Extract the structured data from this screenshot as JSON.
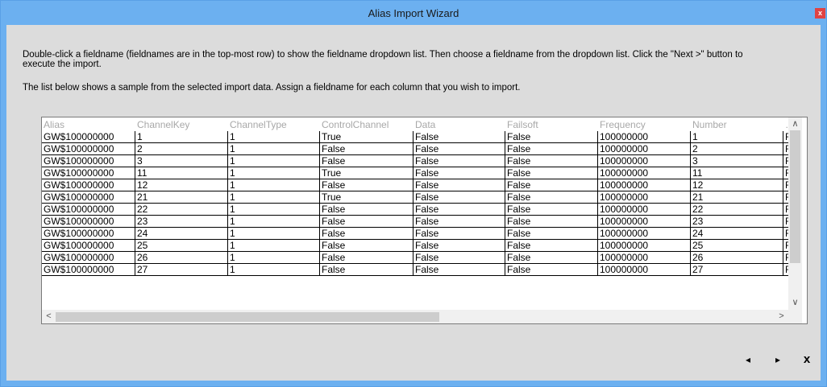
{
  "window": {
    "title": "Alias Import Wizard",
    "close_glyph": "x"
  },
  "instructions": {
    "line1": "Double-click a fieldname (fieldnames are in the top-most row) to show the fieldname dropdown list.  Then choose a fieldname from the dropdown list.  Click the \"Next >\" button to execute the import.",
    "line2": "The list below shows a sample from the selected import data.  Assign a fieldname for each column that you wish to import."
  },
  "grid": {
    "headers": [
      "Alias",
      "ChannelKey",
      "ChannelType",
      "ControlChannel",
      "Data",
      "Failsoft",
      "Frequency",
      "Number",
      "…"
    ],
    "rows": [
      [
        "GW$100000000",
        "1",
        "1",
        "True",
        "False",
        "False",
        "100000000",
        "1",
        "F"
      ],
      [
        "GW$100000000",
        "2",
        "1",
        "False",
        "False",
        "False",
        "100000000",
        "2",
        "F"
      ],
      [
        "GW$100000000",
        "3",
        "1",
        "False",
        "False",
        "False",
        "100000000",
        "3",
        "F"
      ],
      [
        "GW$100000000",
        "11",
        "1",
        "True",
        "False",
        "False",
        "100000000",
        "11",
        "F"
      ],
      [
        "GW$100000000",
        "12",
        "1",
        "False",
        "False",
        "False",
        "100000000",
        "12",
        "F"
      ],
      [
        "GW$100000000",
        "21",
        "1",
        "True",
        "False",
        "False",
        "100000000",
        "21",
        "F"
      ],
      [
        "GW$100000000",
        "22",
        "1",
        "False",
        "False",
        "False",
        "100000000",
        "22",
        "F"
      ],
      [
        "GW$100000000",
        "23",
        "1",
        "False",
        "False",
        "False",
        "100000000",
        "23",
        "F"
      ],
      [
        "GW$100000000",
        "24",
        "1",
        "False",
        "False",
        "False",
        "100000000",
        "24",
        "F"
      ],
      [
        "GW$100000000",
        "25",
        "1",
        "False",
        "False",
        "False",
        "100000000",
        "25",
        "F"
      ],
      [
        "GW$100000000",
        "26",
        "1",
        "False",
        "False",
        "False",
        "100000000",
        "26",
        "F"
      ],
      [
        "GW$100000000",
        "27",
        "1",
        "False",
        "False",
        "False",
        "100000000",
        "27",
        "F"
      ]
    ]
  },
  "scroll": {
    "up": "∧",
    "down": "∨",
    "left": "<",
    "right": ">"
  },
  "nav": {
    "back": "◂",
    "next": "▸",
    "cancel": "x"
  }
}
